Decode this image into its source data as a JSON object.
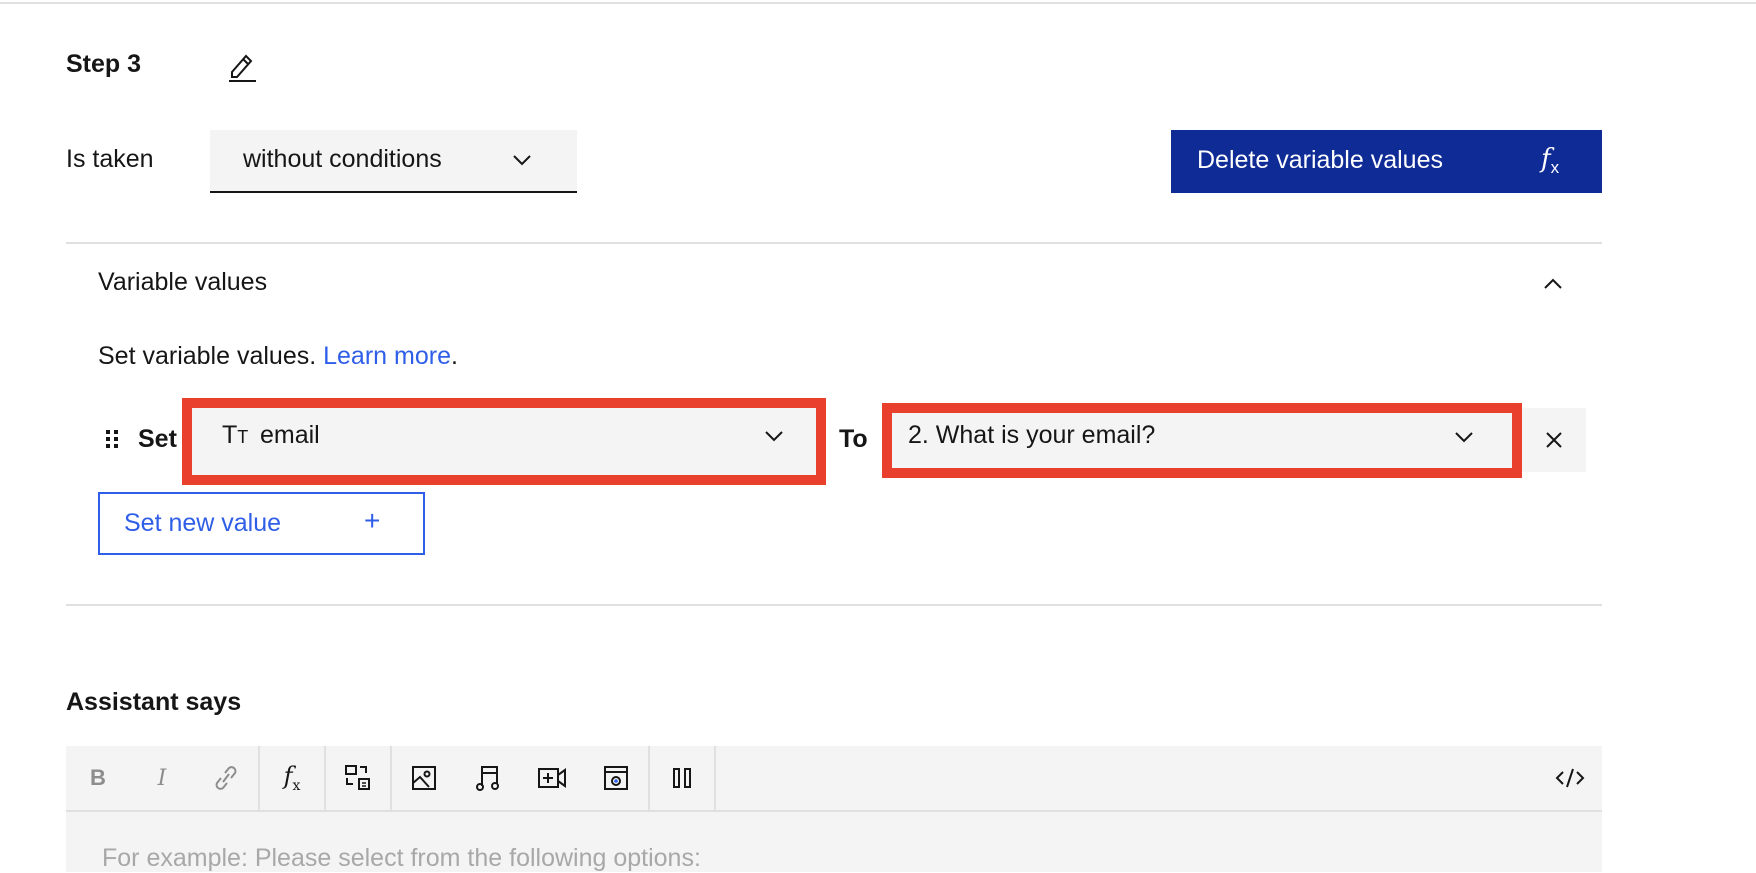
{
  "step": {
    "title": "Step 3",
    "edit_icon": "pencil-icon"
  },
  "condition": {
    "label": "Is taken",
    "selected": "without conditions"
  },
  "delete_button": {
    "label": "Delete variable values",
    "icon": "fx-icon",
    "icon_text": "f",
    "icon_sub": "x"
  },
  "variable_values": {
    "title": "Variable values",
    "description": "Set variable values. ",
    "learn_more": "Learn more",
    "period": ".",
    "row": {
      "set_label": "Set",
      "variable_icon": "Tт",
      "variable": "email",
      "to_label": "To",
      "value": "2. What is your email?"
    },
    "new_value_button": "Set new value",
    "new_value_icon": "+"
  },
  "assistant": {
    "title": "Assistant says",
    "toolbar": [
      "bold",
      "italic",
      "link",
      "function",
      "dialog",
      "image",
      "audio",
      "video",
      "iframe",
      "pause",
      "source-code"
    ],
    "placeholder": "For example: Please select from the following options:"
  },
  "colors": {
    "primary": "#0f2b96",
    "link": "#2f5ee8",
    "highlight": "#e8402c",
    "field": "#f4f4f4"
  }
}
